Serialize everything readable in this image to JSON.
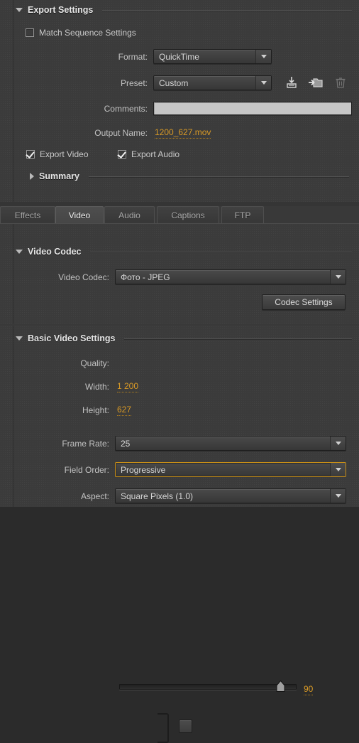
{
  "export_settings": {
    "title": "Export Settings",
    "match_sequence": {
      "label": "Match Sequence Settings",
      "checked": false
    },
    "format": {
      "label": "Format:",
      "value": "QuickTime"
    },
    "preset": {
      "label": "Preset:",
      "value": "Custom"
    },
    "preset_actions": {
      "save": "save-preset-icon",
      "import": "import-preset-icon",
      "delete": "delete-preset-icon"
    },
    "comments": {
      "label": "Comments:",
      "value": "",
      "placeholder": ""
    },
    "output_name": {
      "label": "Output Name:",
      "value": "1200_627.mov"
    },
    "export_video": {
      "label": "Export Video",
      "checked": true
    },
    "export_audio": {
      "label": "Export Audio",
      "checked": true
    },
    "summary": {
      "title": "Summary",
      "expanded": false
    }
  },
  "tabs": [
    {
      "label": "Effects",
      "active": false
    },
    {
      "label": "Video",
      "active": true
    },
    {
      "label": "Audio",
      "active": false
    },
    {
      "label": "Captions",
      "active": false
    },
    {
      "label": "FTP",
      "active": false
    }
  ],
  "video_codec": {
    "title": "Video Codec",
    "codec": {
      "label": "Video Codec:",
      "value": "Фото - JPEG"
    },
    "codec_settings_button": "Codec Settings"
  },
  "basic_video_settings": {
    "title": "Basic Video Settings",
    "quality": {
      "label": "Quality:",
      "value": "90",
      "min": 0,
      "max": 100,
      "percent": 90
    },
    "width": {
      "label": "Width:",
      "value": "1 200"
    },
    "height": {
      "label": "Height:",
      "value": "627"
    },
    "link_dimensions": {
      "name": "link-aspect-toggle",
      "checked": false
    },
    "frame_rate": {
      "label": "Frame Rate:",
      "value": "25"
    },
    "field_order": {
      "label": "Field Order:",
      "value": "Progressive",
      "focused": true
    },
    "aspect": {
      "label": "Aspect:",
      "value": "Square Pixels (1.0)"
    }
  },
  "colors": {
    "panel_bg": "#3b3b3b",
    "accent_orange": "#d99a26",
    "focus_border": "#c98f17",
    "text": "#c9c9c9",
    "heading": "#e6e6e6"
  }
}
